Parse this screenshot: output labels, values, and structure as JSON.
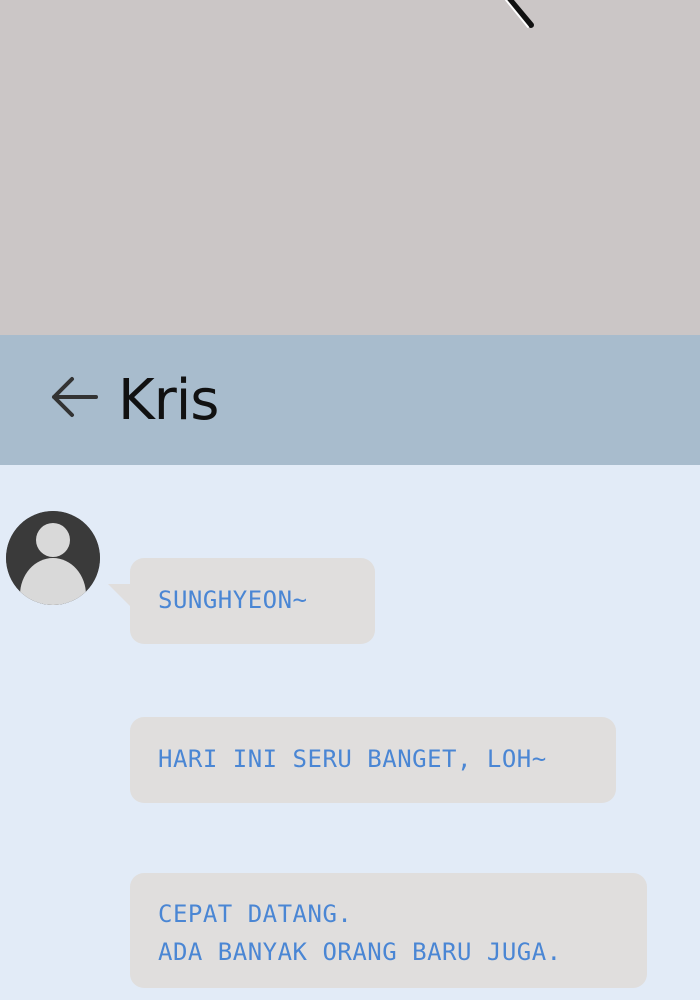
{
  "header": {
    "back_icon": "arrow-left-icon",
    "contact_name": "Kris"
  },
  "colors": {
    "top_panel": "#cbc6c6",
    "header_bar": "#a8bccd",
    "chat_background": "#e2ebf7",
    "bubble_background": "#e0dedd",
    "message_text": "#4a86d4",
    "avatar_dark": "#3a3a3a",
    "avatar_light": "#d9d9d9"
  },
  "chat": {
    "avatar_icon": "default-user-avatar-icon",
    "messages": [
      {
        "lines": [
          "SUNGHYEON~"
        ]
      },
      {
        "lines": [
          "HARI INI SERU BANGET, LOH~"
        ]
      },
      {
        "lines": [
          "CEPAT DATANG.",
          "ADA BANYAK ORANG BARU JUGA."
        ]
      }
    ]
  }
}
